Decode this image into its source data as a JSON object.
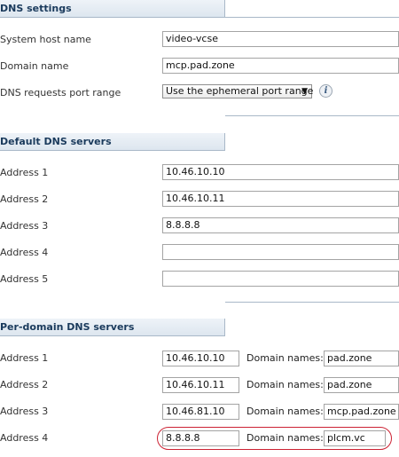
{
  "dns_settings": {
    "title": "DNS settings",
    "system_host_name": {
      "label": "System host name",
      "value": "video-vcse"
    },
    "domain_name": {
      "label": "Domain name",
      "value": "mcp.pad.zone"
    },
    "port_range": {
      "label": "DNS requests port range",
      "selected": "Use the ephemeral port range",
      "arrow": "▼",
      "info": "i"
    }
  },
  "default_dns": {
    "title": "Default DNS servers",
    "addresses": [
      {
        "label": "Address 1",
        "value": "10.46.10.10"
      },
      {
        "label": "Address 2",
        "value": "10.46.10.11"
      },
      {
        "label": "Address 3",
        "value": "8.8.8.8"
      },
      {
        "label": "Address 4",
        "value": ""
      },
      {
        "label": "Address 5",
        "value": ""
      }
    ]
  },
  "per_domain_dns": {
    "title": "Per-domain DNS servers",
    "domain_names_label": "Domain names:",
    "rows": [
      {
        "label": "Address 1",
        "address": "10.46.10.10",
        "domains": "pad.zone"
      },
      {
        "label": "Address 2",
        "address": "10.46.10.11",
        "domains": "pad.zone"
      },
      {
        "label": "Address 3",
        "address": "10.46.81.10",
        "domains": "mcp.pad.zone"
      },
      {
        "label": "Address 4",
        "address": "8.8.8.8",
        "domains": "plcm.vc"
      }
    ]
  },
  "colors": {
    "section_header_text": "#1a3a5c",
    "highlight_outline": "#cc2233"
  }
}
